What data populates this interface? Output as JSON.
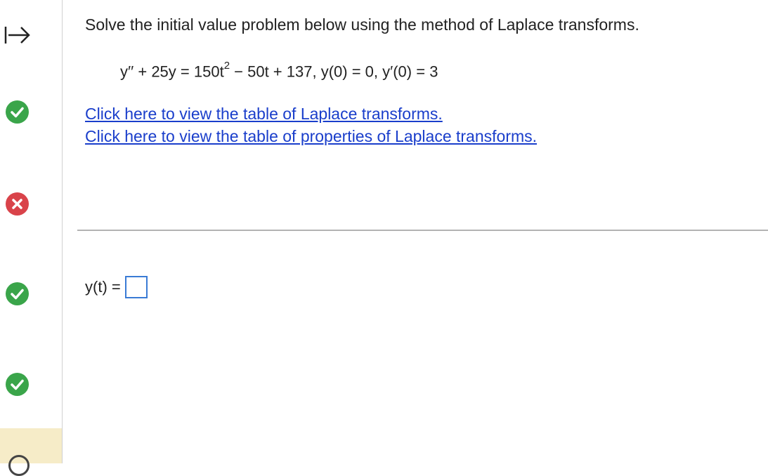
{
  "sidebar": {
    "items": [
      {
        "status": "correct",
        "icon": "checkmark-icon",
        "color": "#3aa54a"
      },
      {
        "status": "incorrect",
        "icon": "cross-icon",
        "color": "#d9434a"
      },
      {
        "status": "correct",
        "icon": "checkmark-icon",
        "color": "#3aa54a"
      },
      {
        "status": "correct",
        "icon": "checkmark-icon",
        "color": "#3aa54a"
      },
      {
        "status": "current",
        "icon": "circle-icon",
        "color": "#444444"
      }
    ],
    "current_highlight_color": "#f6ecc8"
  },
  "question": {
    "instruction": "Solve the initial value problem below using the method of Laplace transforms.",
    "equation": {
      "lhs": "y′′ + 25y = 150t",
      "exponent": "2",
      "rest": " − 50t + 137, y(0) = 0, y′(0) = 3"
    },
    "links": [
      "Click here to view the table of Laplace transforms.",
      "Click here to view the table of properties of Laplace transforms."
    ],
    "link_color": "#1a3ecb"
  },
  "answer": {
    "label": "y(t) =",
    "value": ""
  }
}
